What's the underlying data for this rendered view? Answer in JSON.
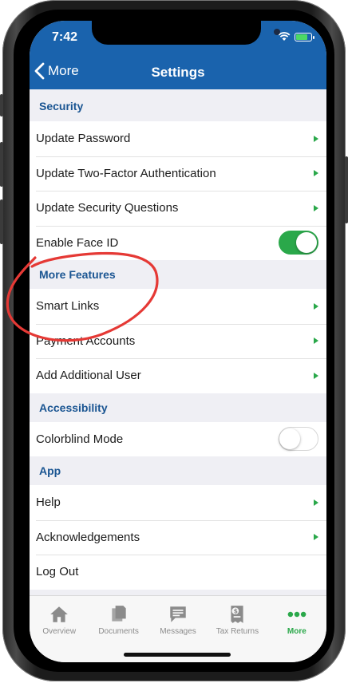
{
  "status_bar": {
    "time": "7:42"
  },
  "nav": {
    "back_label": "More",
    "title": "Settings"
  },
  "sections": [
    {
      "title": "Security",
      "rows": [
        "Update Password",
        "Update Two-Factor Authentication",
        "Update Security Questions",
        "Enable Face ID"
      ]
    },
    {
      "title": "More Features",
      "rows": [
        "Smart Links",
        "Payment Accounts",
        "Add Additional User"
      ]
    },
    {
      "title": "Accessibility",
      "rows": [
        "Colorblind Mode"
      ]
    },
    {
      "title": "App",
      "rows": [
        "Help",
        "Acknowledgements",
        "Log Out"
      ]
    }
  ],
  "toggles": {
    "face_id": true,
    "colorblind_mode": false
  },
  "tabs": [
    "Overview",
    "Documents",
    "Messages",
    "Tax Returns",
    "More"
  ],
  "colors": {
    "nav_bg": "#1a63ad",
    "accent": "#2aa84a",
    "section_text": "#1a5592",
    "annotation": "#e53935"
  }
}
